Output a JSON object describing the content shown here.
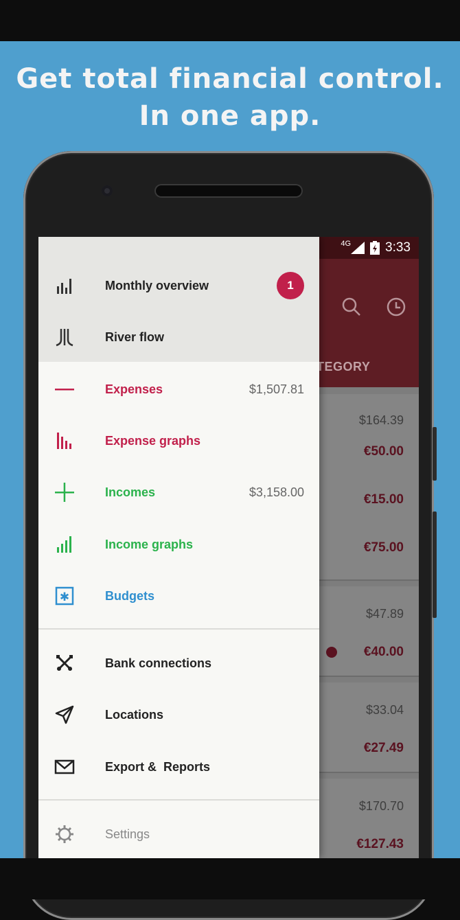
{
  "headline": {
    "line1": "Get total financial control.",
    "line2": "In one app."
  },
  "status_bar": {
    "network": "4G",
    "time": "3:33"
  },
  "app_behind": {
    "tab_label": "TEGORY",
    "icons": [
      "search-icon",
      "history-icon"
    ],
    "rows": [
      {
        "total": "$164.39",
        "amounts": [
          "€50.00",
          "€15.00",
          "€75.00"
        ]
      },
      {
        "total": "$47.89",
        "amounts": [
          "€40.00"
        ]
      },
      {
        "total": "$33.04",
        "amounts": [
          "€27.49"
        ]
      },
      {
        "total": "$170.70",
        "amounts": [
          "€127.43"
        ]
      }
    ]
  },
  "drawer": {
    "items": [
      {
        "label": "Monthly overview",
        "icon": "bar-chart-icon",
        "badge": "1",
        "color": "#222222"
      },
      {
        "label": "River flow",
        "icon": "river-flow-icon",
        "color": "#222222"
      },
      {
        "label": "Expenses",
        "icon": "minus-icon",
        "value": "$1,507.81",
        "color": "#c1204b"
      },
      {
        "label": "Expense graphs",
        "icon": "expense-graph-icon",
        "color": "#c1204b"
      },
      {
        "label": "Incomes",
        "icon": "plus-icon",
        "value": "$3,158.00",
        "color": "#2bb24c"
      },
      {
        "label": "Income graphs",
        "icon": "income-graph-icon",
        "color": "#2bb24c"
      },
      {
        "label": "Budgets",
        "icon": "budget-icon",
        "color": "#2f8fcf"
      },
      {
        "label": "Bank connections",
        "icon": "bank-connections-icon",
        "color": "#222222"
      },
      {
        "label": "Locations",
        "icon": "location-arrow-icon",
        "color": "#222222"
      },
      {
        "label": "Export &  Reports",
        "icon": "mail-icon",
        "color": "#222222"
      },
      {
        "label": "Settings",
        "icon": "gear-icon",
        "color": "#888888"
      }
    ]
  },
  "colors": {
    "accent_red": "#c1204b",
    "accent_green": "#2bb24c",
    "accent_blue": "#2f8fcf",
    "toolbar": "#5e1d24",
    "background": "#4f9fce"
  }
}
